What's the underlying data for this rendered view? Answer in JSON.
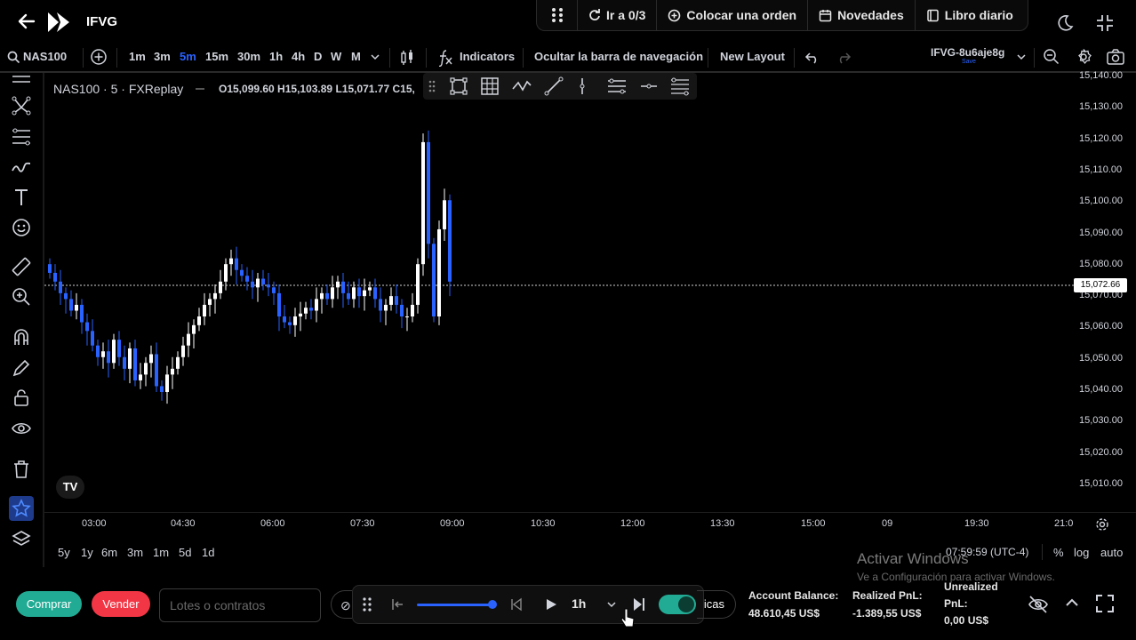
{
  "app": {
    "title": "IFVG",
    "top_actions": [
      {
        "icon": "grid-dots-icon",
        "label": ""
      },
      {
        "icon": "reload-arrow-icon",
        "label": "Ir a 0/3"
      },
      {
        "icon": "plus-circle-icon",
        "label": "Colocar una orden"
      },
      {
        "icon": "calendar-icon",
        "label": "Novedades"
      },
      {
        "icon": "book-icon",
        "label": "Libro diario"
      }
    ]
  },
  "toolbar": {
    "symbol": "NAS100",
    "timeframes": [
      "1m",
      "3m",
      "5m",
      "15m",
      "30m",
      "1h",
      "4h",
      "D",
      "W",
      "M"
    ],
    "active_timeframe": "5m",
    "indicators_label": "Indicators",
    "hide_nav_label": "Ocultar la barra de navegación",
    "new_layout_label": "New Layout",
    "layout_name": "IFVG-8u6aje8g",
    "layout_save": "Save"
  },
  "chart": {
    "legend": "NAS100 · 5 · FXReplay",
    "ohlc": "O15,099.60 H15,103.89 L15,071.77 C15,",
    "current_price": "15,072.66",
    "price_labels": [
      "15,140.00",
      "15,130.00",
      "15,120.00",
      "15,110.00",
      "15,100.00",
      "15,090.00",
      "15,080.00",
      "15,070.00",
      "15,060.00",
      "15,050.00",
      "15,040.00",
      "15,030.00",
      "15,020.00",
      "15,010.00"
    ],
    "time_labels": [
      "03:00",
      "04:30",
      "06:00",
      "07:30",
      "09:00",
      "10:30",
      "12:00",
      "13:30",
      "15:00",
      "09",
      "19:30",
      "21:0"
    ],
    "range_buttons": [
      "5y",
      "1y",
      "6m",
      "3m",
      "1m",
      "5d",
      "1d"
    ],
    "clock": "07:59:59 (UTC-4)",
    "axis_options": [
      "%",
      "log",
      "auto"
    ],
    "tv_logo": "TV"
  },
  "watermark": {
    "line1": "Activar Windows",
    "line2": "Ve a Configuración para activar Windows."
  },
  "bottom": {
    "buy_label": "Comprar",
    "sell_label": "Vender",
    "lots_placeholder": "Lotes o contratos",
    "replay_speed": "1h",
    "tacticas_label": "icas",
    "account_balance_label": "Account Balance:",
    "account_balance_value": "48.610,45 US$",
    "realized_label": "Realized PnL:",
    "realized_value": "-1.389,55 US$",
    "unrealized_label": "Unrealized",
    "unrealized_label2": "PnL:",
    "unrealized_value": "0,00 US$"
  },
  "colors": {
    "bull": "#ffffff",
    "bear": "#2962ff",
    "accent": "#2962ff",
    "buy": "#22ab94",
    "sell": "#f23645"
  }
}
